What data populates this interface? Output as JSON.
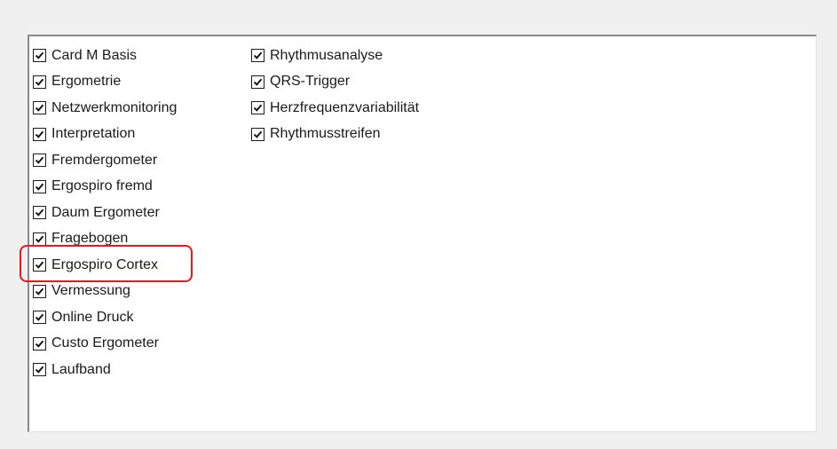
{
  "options": {
    "column1": [
      {
        "label": "Card M Basis",
        "checked": true
      },
      {
        "label": "Ergometrie",
        "checked": true
      },
      {
        "label": "Netzwerkmonitoring",
        "checked": true
      },
      {
        "label": "Interpretation",
        "checked": true
      },
      {
        "label": "Fremdergometer",
        "checked": true
      },
      {
        "label": "Ergospiro fremd",
        "checked": true
      },
      {
        "label": "Daum Ergometer",
        "checked": true
      },
      {
        "label": "Fragebogen",
        "checked": true
      },
      {
        "label": "Ergospiro Cortex",
        "checked": true
      },
      {
        "label": "Vermessung",
        "checked": true
      },
      {
        "label": "Online Druck",
        "checked": true
      },
      {
        "label": "Custo Ergometer",
        "checked": true
      },
      {
        "label": "Laufband",
        "checked": true
      }
    ],
    "column2": [
      {
        "label": "Rhythmusanalyse",
        "checked": true
      },
      {
        "label": "QRS-Trigger",
        "checked": true
      },
      {
        "label": "Herzfrequenzvariabilität",
        "checked": true
      },
      {
        "label": "Rhythmusstreifen",
        "checked": true
      }
    ]
  },
  "highlighted_option": "Ergospiro Cortex",
  "colors": {
    "highlight": "#e31b1b",
    "panel_background": "#ffffff",
    "window_background": "#f0f0f0"
  }
}
